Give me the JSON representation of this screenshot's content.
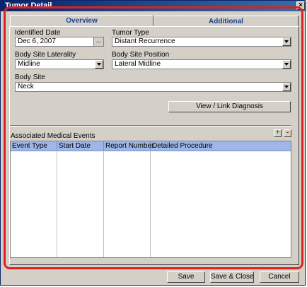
{
  "window": {
    "title": "Tumor Detail",
    "close": "×"
  },
  "tabs": [
    {
      "label": "Overview"
    },
    {
      "label": "Additional"
    }
  ],
  "form": {
    "identified_date_label": "Identified Date",
    "identified_date_value": "Dec 6, 2007",
    "date_picker_glyph": "...",
    "tumor_type_label": "Tumor Type",
    "tumor_type_value": "Distant Recurrence",
    "laterality_label": "Body Site Laterality",
    "laterality_value": "Midline",
    "position_label": "Body Site Position",
    "position_value": "Lateral Midline",
    "body_site_label": "Body Site",
    "body_site_value": "Neck"
  },
  "view_link_button": "View / Link Diagnosis",
  "events": {
    "title": "Associated Medical Events",
    "add_glyph": "+",
    "remove_glyph": "-",
    "columns": [
      "Event Type",
      "Start Date",
      "Report Number",
      "Detailed Procedure"
    ]
  },
  "footer": {
    "save": "Save",
    "save_close": "Save & Close",
    "cancel": "Cancel"
  },
  "colors": {
    "highlight": "#e02020",
    "grid_header": "#9eb6e8",
    "titlebar": "#0a246a"
  }
}
